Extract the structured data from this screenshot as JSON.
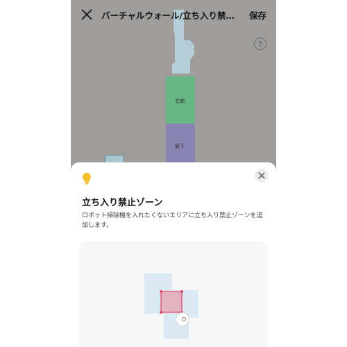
{
  "header": {
    "title": "バーチャルウォール/立ち入り禁止ゾーン",
    "save_label": "保存",
    "help_glyph": "?"
  },
  "map": {
    "rooms": [
      {
        "name": "玄関",
        "color": "#68b683"
      },
      {
        "name": "廊下",
        "color": "#8a84b3"
      }
    ],
    "room_light_color": "#b3ced6"
  },
  "sheet": {
    "title": "立ち入り禁止ゾーン",
    "description": "ロボット掃除機を入れたくないエリアに立ち入り禁止ゾーンを追加します。"
  },
  "colors": {
    "bulb": "#f3bf2c",
    "zone_fill": "#e3b3c1",
    "zone_border": "#e04a6a"
  }
}
